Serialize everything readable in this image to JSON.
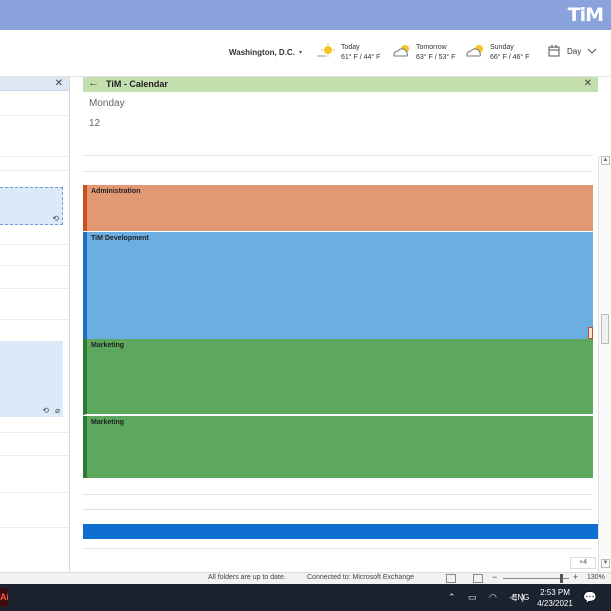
{
  "app": {
    "logo": "TiM"
  },
  "ribbon": {
    "location": "Washington, D.C.",
    "location_caret": "▾",
    "weather": [
      {
        "day": "Today",
        "temp": "61° F / 44° F",
        "icon": "sunny-icon"
      },
      {
        "day": "Tomorrow",
        "temp": "63° F / 53° F",
        "icon": "partly-cloudy-icon"
      },
      {
        "day": "Sunday",
        "temp": "66° F / 46° F",
        "icon": "partly-sunny-icon"
      }
    ],
    "view_label": "Day"
  },
  "left_pane": {
    "close": "✕"
  },
  "calendar": {
    "title": "TiM - Calendar",
    "back": "←",
    "close": "✕",
    "day_name": "Monday",
    "day_number": "12",
    "appointments": [
      {
        "label": "Administration",
        "color": "#e39874",
        "border": "#c8521f"
      },
      {
        "label": "TiM Development",
        "color": "#6aaee4",
        "border": "#1f6fc4"
      },
      {
        "label": "Marketing",
        "color": "#5ba85e",
        "border": "#2f7a31"
      },
      {
        "label": "Marketing",
        "color": "#5ba85e",
        "border": "#2f7a31"
      }
    ],
    "more_badge": "+4"
  },
  "status_bar": {
    "sync": "All folders are up to date.",
    "connection": "Connected to: Microsoft Exchange",
    "zoom_minus": "−",
    "zoom_plus": "+",
    "zoom": "130%"
  },
  "taskbar": {
    "app_glyph": "Ai",
    "tray": "⌃ ▭ ◠ ◁)",
    "lang": "ENG",
    "time": "2:53 PM",
    "date": "4/23/2021",
    "notif": "💬"
  }
}
